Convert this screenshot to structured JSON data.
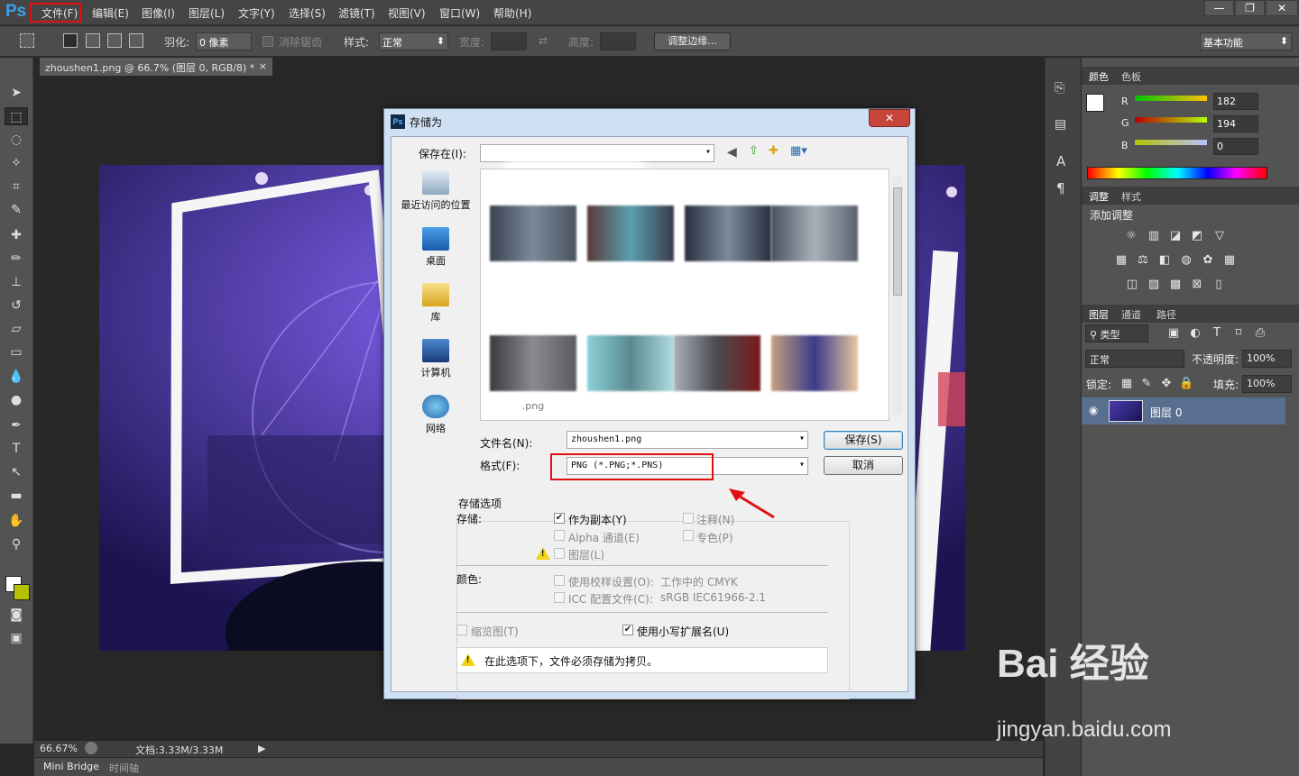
{
  "app": {
    "logo": "Ps"
  },
  "menubar": {
    "items": [
      "文件(F)",
      "编辑(E)",
      "图像(I)",
      "图层(L)",
      "文字(Y)",
      "选择(S)",
      "滤镜(T)",
      "视图(V)",
      "窗口(W)",
      "帮助(H)"
    ],
    "window_controls": [
      "—",
      "❐",
      "✕"
    ]
  },
  "options_bar": {
    "feather_label": "羽化:",
    "feather_value": "0 像素",
    "antialias_label": "消除锯齿",
    "style_label": "样式:",
    "style_value": "正常",
    "width_label": "宽度:",
    "height_label": "高度:",
    "refine_edge_button": "调整边缘...",
    "workspace": "基本功能"
  },
  "document": {
    "tab_title": "zhoushen1.png @ 66.7% (图层 0, RGB/8) *",
    "tab_close": "×",
    "zoom": "66.67%",
    "doc_size": "文档:3.33M/3.33M"
  },
  "bottom_tabs": [
    "Mini Bridge",
    "时间轴"
  ],
  "tools": [
    "move-tool",
    "marquee-tool",
    "lasso-tool",
    "magic-wand-tool",
    "crop-tool",
    "eyedropper-tool",
    "healing-brush-tool",
    "brush-tool",
    "clone-stamp-tool",
    "history-brush-tool",
    "eraser-tool",
    "gradient-tool",
    "blur-tool",
    "dodge-tool",
    "pen-tool",
    "type-tool",
    "path-selection-tool",
    "rectangle-tool",
    "hand-tool",
    "zoom-tool"
  ],
  "colors": {
    "foreground": "#ffffff",
    "background": "#b6c200",
    "accent_red": "#e01010"
  },
  "color_panel": {
    "tabs": [
      "颜色",
      "色板"
    ],
    "r_label": "R",
    "r_value": "182",
    "g_label": "G",
    "g_value": "194",
    "b_label": "B",
    "b_value": "0"
  },
  "adjust_panel": {
    "tabs": [
      "调整",
      "样式"
    ],
    "title": "添加调整"
  },
  "layers_panel": {
    "tabs": [
      "图层",
      "通道",
      "路径"
    ],
    "filter_kind": "类型",
    "blend_mode": "正常",
    "opacity_label": "不透明度:",
    "opacity_value": "100%",
    "lock_label": "锁定:",
    "fill_label": "填充:",
    "fill_value": "100%",
    "layer_name": "图层 0"
  },
  "dialog": {
    "title": "存储为",
    "close": "✕",
    "save_in_label": "保存在(I):",
    "places": [
      "最近访问的位置",
      "桌面",
      "库",
      "计算机",
      "网络"
    ],
    "file_labels_row2": [
      ".png",
      "",
      "",
      ""
    ],
    "filename_label": "文件名(N):",
    "filename_value": "zhoushen1.png",
    "format_label": "格式(F):",
    "format_value": "PNG (*.PNG;*.PNS)",
    "save_button": "保存(S)",
    "cancel_button": "取消",
    "save_options_title": "存储选项",
    "save_label": "存储:",
    "as_copy": "作为副本(Y)",
    "notes": "注释(N)",
    "alpha_channels": "Alpha 通道(E)",
    "spot_colors": "专色(P)",
    "layers": "图层(L)",
    "color_label": "颜色:",
    "use_proof_setup": "使用校样设置(O):",
    "working_cmyk": "工作中的 CMYK",
    "icc_profile": "ICC 配置文件(C):",
    "icc_value": "sRGB IEC61966-2.1",
    "thumbnail": "缩览图(T)",
    "lowercase_ext": "使用小写扩展名(U)",
    "warning": "在此选项下，文件必须存储为拷贝。"
  },
  "watermark": {
    "brand": "Bai 经验",
    "url": "jingyan.baidu.com"
  }
}
